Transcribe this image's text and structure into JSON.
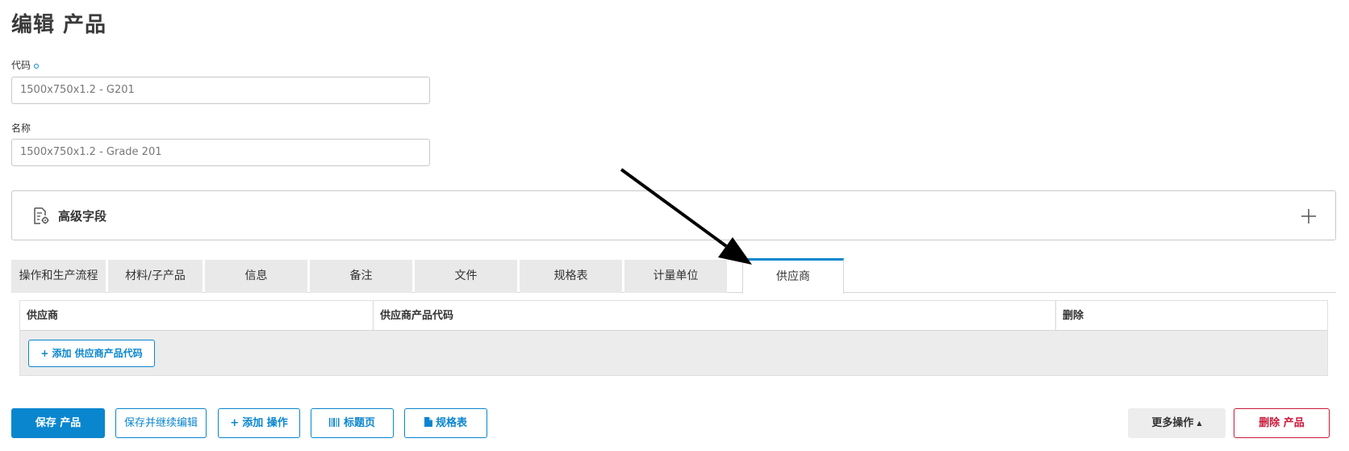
{
  "page": {
    "title": "编辑 产品"
  },
  "form": {
    "code": {
      "label": "代码",
      "value": "1500x750x1.2 - G201"
    },
    "name": {
      "label": "名称",
      "value": "1500x750x1.2 - Grade 201"
    }
  },
  "advanced": {
    "label": "高级字段"
  },
  "tabs": [
    {
      "label": "操作和生产流程"
    },
    {
      "label": "材料/子产品"
    },
    {
      "label": "信息"
    },
    {
      "label": "备注"
    },
    {
      "label": "文件"
    },
    {
      "label": "规格表"
    },
    {
      "label": "计量单位"
    },
    {
      "label": "供应商",
      "active": true
    }
  ],
  "supplier_table": {
    "columns": [
      "供应商",
      "供应商产品代码",
      "删除"
    ],
    "add_button": "添加 供应商产品代码"
  },
  "actions": {
    "save": "保存 产品",
    "save_continue": "保存并继续编辑",
    "add_operation": "添加 操作",
    "title_page": "标题页",
    "spec_sheet": "规格表",
    "more": "更多操作",
    "delete": "删除 产品"
  },
  "colors": {
    "accent": "#0a86cf",
    "danger": "#c9193a",
    "tab_inactive": "#e9e9e9"
  },
  "icons": {
    "required": "required-dot-icon",
    "advanced": "document-gear-icon",
    "expand": "plus-icon",
    "add": "plus-icon",
    "barcode": "barcode-icon",
    "file": "file-icon",
    "caret": "caret-up-icon",
    "pointer": "arrow-annotation"
  }
}
